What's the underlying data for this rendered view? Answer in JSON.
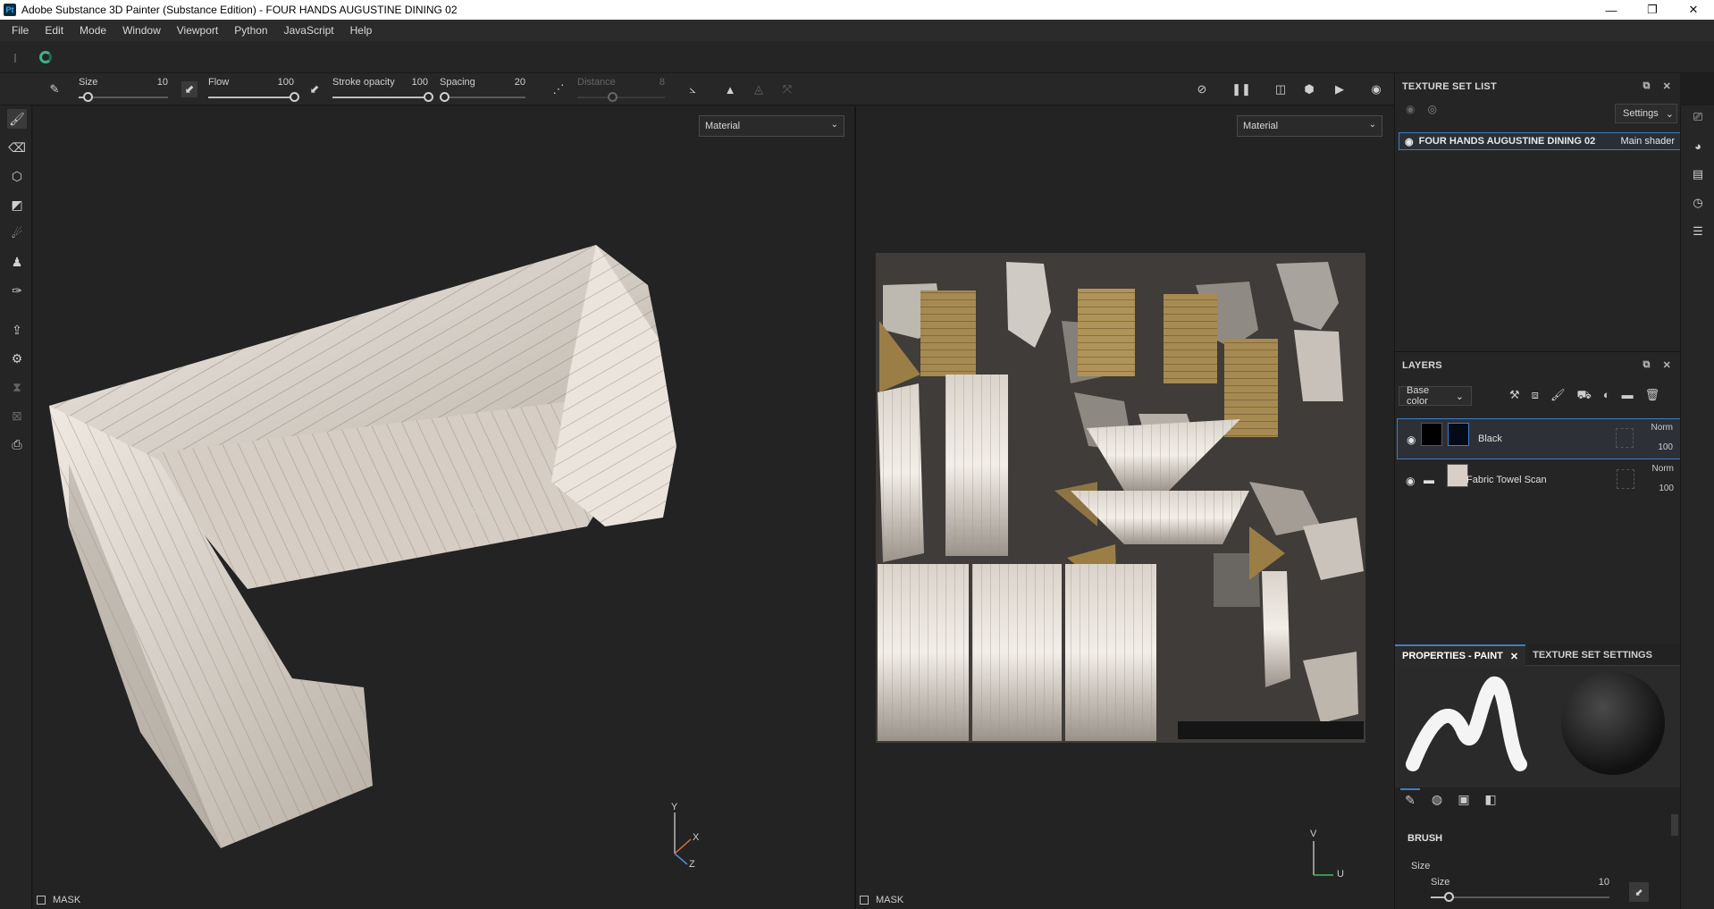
{
  "window": {
    "app_icon": "Pt",
    "title": "Adobe Substance 3D Painter (Substance Edition) - FOUR HANDS AUGUSTINE DINING 02",
    "minimize": "—",
    "maximize": "❐",
    "close": "✕"
  },
  "menu": [
    "File",
    "Edit",
    "Mode",
    "Window",
    "Viewport",
    "Python",
    "JavaScript",
    "Help"
  ],
  "toolbar": {
    "size": {
      "label": "Size",
      "value": "10",
      "fraction": 0.1
    },
    "flow": {
      "label": "Flow",
      "value": "100",
      "fraction": 1.0
    },
    "stroke_opacity": {
      "label": "Stroke opacity",
      "value": "100",
      "fraction": 1.0
    },
    "spacing": {
      "label": "Spacing",
      "value": "20",
      "fraction": 0.05
    },
    "distance": {
      "label": "Distance",
      "value": "8",
      "fraction": 0.4
    }
  },
  "viewport3d": {
    "material_select": "Material",
    "mask_label": "MASK",
    "axes": {
      "y": "Y",
      "x": "X",
      "z": "Z"
    }
  },
  "viewport2d": {
    "material_select": "Material",
    "mask_label": "MASK",
    "axes": {
      "v": "V",
      "u": "U"
    }
  },
  "texture_set_list": {
    "title": "TEXTURE SET LIST",
    "settings_label": "Settings",
    "item_name": "FOUR HANDS AUGUSTINE DINING 02",
    "item_shader": "Main shader"
  },
  "layers": {
    "title": "LAYERS",
    "channel": "Base color",
    "rows": [
      {
        "name": "Black",
        "blend": "Norm",
        "opacity": "100"
      },
      {
        "name": "Fabric Towel Scan",
        "blend": "Norm",
        "opacity": "100"
      }
    ]
  },
  "properties": {
    "tab_paint": "PROPERTIES - PAINT",
    "tab_texture_set": "TEXTURE SET SETTINGS",
    "section": "BRUSH",
    "size_group": "Size",
    "size_label": "Size",
    "size_value": "10",
    "size_fraction": 0.1
  },
  "colors": {
    "accent": "#3d7fc4",
    "spinner": "#3bb38c"
  }
}
